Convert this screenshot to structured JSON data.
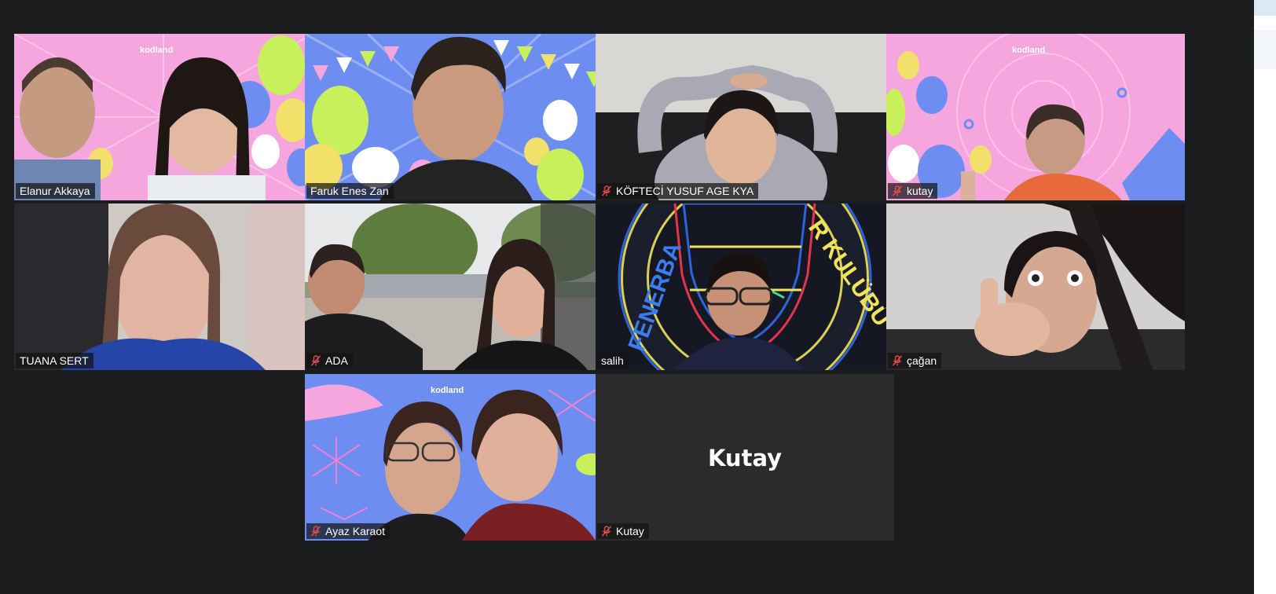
{
  "participants": [
    {
      "name": "Elanur Akkaya",
      "muted": false,
      "active_speaker": true
    },
    {
      "name": "Faruk Enes Zan",
      "muted": false
    },
    {
      "name": "KÖFTECİ YUSUF AGE KYA",
      "muted": true
    },
    {
      "name": "kutay",
      "muted": true
    },
    {
      "name": "TUANA SERT",
      "muted": false
    },
    {
      "name": "ADA",
      "muted": true
    },
    {
      "name": "salih",
      "muted": false
    },
    {
      "name": "çağan",
      "muted": true
    },
    {
      "name": "Ayaz Karaot",
      "muted": true
    },
    {
      "name": "Kutay",
      "muted": true,
      "avatar_text": "Kutay"
    }
  ],
  "backgrounds": {
    "brand_text": "kodland",
    "sign_text": "FENERBAHÇE SPOR KULÜBÜ"
  },
  "colors": {
    "meeting_bg": "#1b1c1e",
    "active_border": "#e8e88a",
    "mute_icon": "#e24a4a",
    "nametag_bg": "rgba(20,20,20,0.72)"
  }
}
